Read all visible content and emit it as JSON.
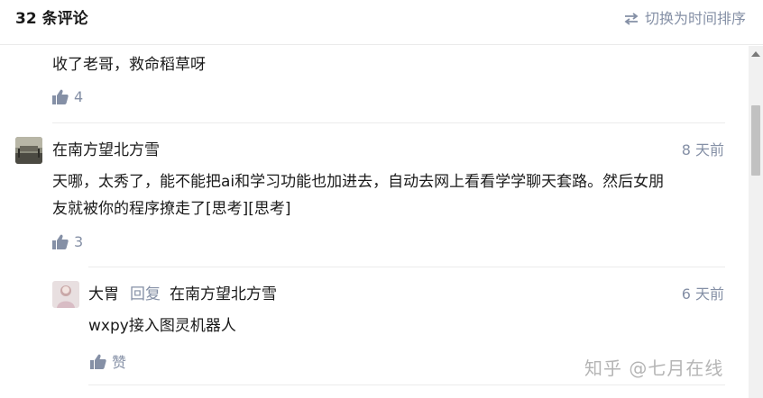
{
  "header": {
    "title": "32 条评论",
    "sort_toggle_label": "切换为时间排序",
    "sort_icon": "swap-arrows-icon"
  },
  "comments": [
    {
      "text": "收了老哥，救命稻草呀",
      "likes": "4"
    },
    {
      "author": "在南方望北方雪",
      "time": "8 天前",
      "text_line1": "天哪，太秀了，能不能把ai和学习功能也加进去，自动去网上看看学学聊天套路。然后女朋",
      "text_line2": "友就被你的程序撩走了[思考][思考]",
      "likes": "3"
    }
  ],
  "reply": {
    "author": "大胃",
    "reply_label": "回复",
    "reply_to": "在南方望北方雪",
    "time": "6 天前",
    "text": "wxpy接入图灵机器人",
    "like_label": "赞"
  },
  "watermark": "知乎 @七月在线",
  "colors": {
    "muted": "#8590a6",
    "text": "#1a1a1a",
    "divider": "#ebebeb"
  }
}
